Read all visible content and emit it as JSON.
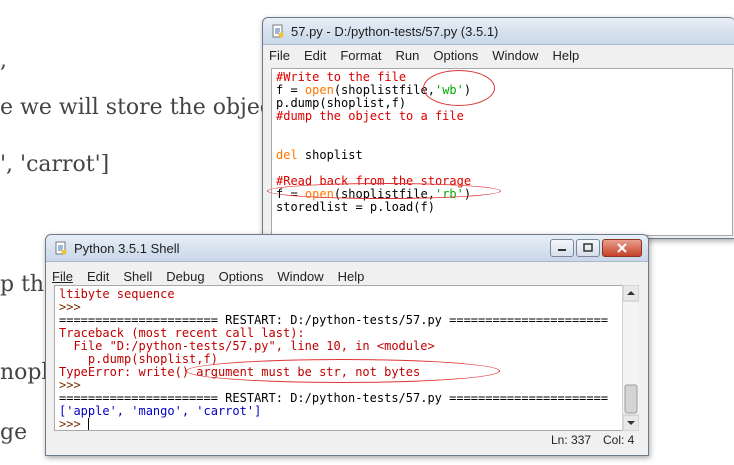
{
  "background": {
    "lines": [
      ",",
      "e we will store the object",
      "', 'carrot']",
      "p the",
      "nopli",
      "ge"
    ]
  },
  "editor_window": {
    "title": "57.py - D:/python-tests/57.py (3.5.1)",
    "menu": [
      "File",
      "Edit",
      "Format",
      "Run",
      "Options",
      "Window",
      "Help"
    ],
    "code": [
      [
        {
          "t": "#Write to the file",
          "c": "comment"
        }
      ],
      [
        {
          "t": "f = ",
          "c": "def"
        },
        {
          "t": "open",
          "c": "kw"
        },
        {
          "t": "(shoplistfile,",
          "c": "def"
        },
        {
          "t": "'wb'",
          "c": "str"
        },
        {
          "t": ")",
          "c": "def"
        }
      ],
      [
        {
          "t": "p.dump(shoplist,f)",
          "c": "def"
        }
      ],
      [
        {
          "t": "#dump the object to a file",
          "c": "comment"
        }
      ],
      [
        {
          "t": "",
          "c": "def"
        }
      ],
      [
        {
          "t": "",
          "c": "def"
        }
      ],
      [
        {
          "t": "del",
          "c": "kw"
        },
        {
          "t": " shoplist",
          "c": "def"
        }
      ],
      [
        {
          "t": "",
          "c": "def"
        }
      ],
      [
        {
          "t": "#Read back from the storage",
          "c": "comment"
        }
      ],
      [
        {
          "t": "f = ",
          "c": "def"
        },
        {
          "t": "open",
          "c": "kw"
        },
        {
          "t": "(shoplistfile,",
          "c": "def"
        },
        {
          "t": "'rb'",
          "c": "str"
        },
        {
          "t": ")",
          "c": "def"
        }
      ],
      [
        {
          "t": "storedlist = p.load(f)",
          "c": "def"
        }
      ]
    ]
  },
  "shell_window": {
    "title": "Python 3.5.1 Shell",
    "menu": [
      "File",
      "Edit",
      "Shell",
      "Debug",
      "Options",
      "Window",
      "Help"
    ],
    "output": [
      [
        {
          "t": "ltibyte sequence",
          "c": "err"
        }
      ],
      [
        {
          "t": ">>> ",
          "c": "prompt"
        }
      ],
      [
        {
          "t": "====================== RESTART: D:/python-tests/57.py ======================",
          "c": "sep"
        }
      ],
      [
        {
          "t": "Traceback (most recent call last):",
          "c": "err"
        }
      ],
      [
        {
          "t": "  File \"D:/python-tests/57.py\", line 10, in <module>",
          "c": "err"
        }
      ],
      [
        {
          "t": "    p.dump(shoplist,f)",
          "c": "err"
        }
      ],
      [
        {
          "t": "TypeError: write() argument must be str, not bytes",
          "c": "err"
        }
      ],
      [
        {
          "t": ">>> ",
          "c": "prompt"
        }
      ],
      [
        {
          "t": "====================== RESTART: D:/python-tests/57.py ======================",
          "c": "sep"
        }
      ],
      [
        {
          "t": "['apple', 'mango', 'carrot']",
          "c": "out"
        }
      ],
      [
        {
          "t": ">>> ",
          "c": "prompt"
        }
      ]
    ],
    "status": {
      "line": "Ln: 337",
      "col": "Col: 4"
    }
  },
  "colors": {
    "comment": "#dd0000",
    "keyword": "#ff7700",
    "string": "#00aa00",
    "error": "#c00000",
    "output": "#0000c0",
    "annotation": "#e03535"
  }
}
